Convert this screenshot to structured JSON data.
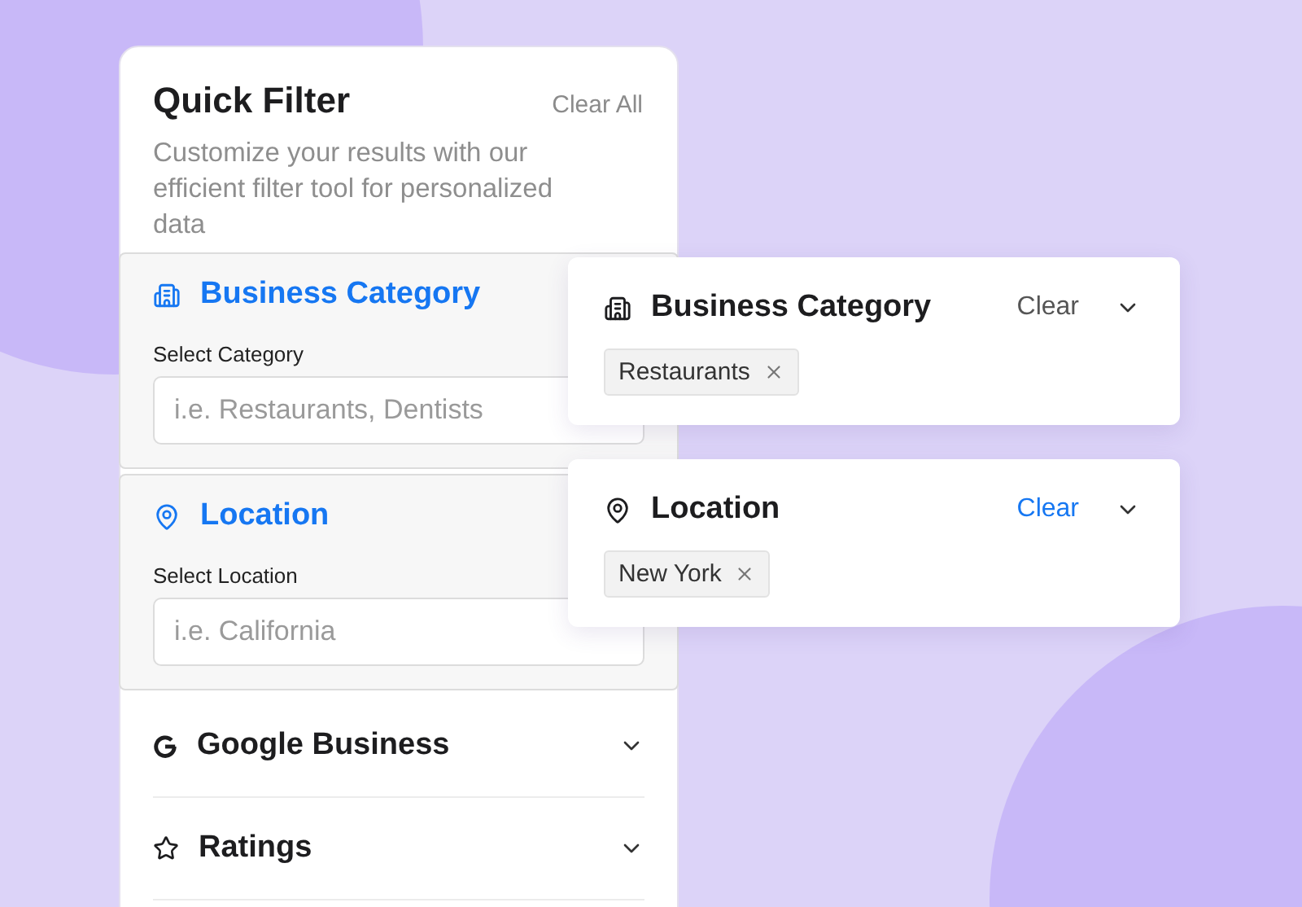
{
  "panel": {
    "title": "Quick Filter",
    "clear_all": "Clear All",
    "description": "Customize your results with our efficient filter tool for personalized data",
    "sections": [
      {
        "kind": "expanded",
        "title": "Business Category",
        "field_label": "Select Category",
        "placeholder": "i.e. Restaurants, Dentists"
      },
      {
        "kind": "expanded",
        "title": "Location",
        "field_label": "Select Location",
        "placeholder": "i.e. California"
      },
      {
        "kind": "collapsed",
        "title": "Google Business"
      },
      {
        "kind": "collapsed",
        "title": "Ratings"
      }
    ]
  },
  "applied_filters": [
    {
      "title": "Business Category",
      "clear": "Clear",
      "clear_active": false,
      "tags": [
        "Restaurants"
      ]
    },
    {
      "title": "Location",
      "clear": "Clear",
      "clear_active": true,
      "tags": [
        "New York"
      ]
    }
  ]
}
